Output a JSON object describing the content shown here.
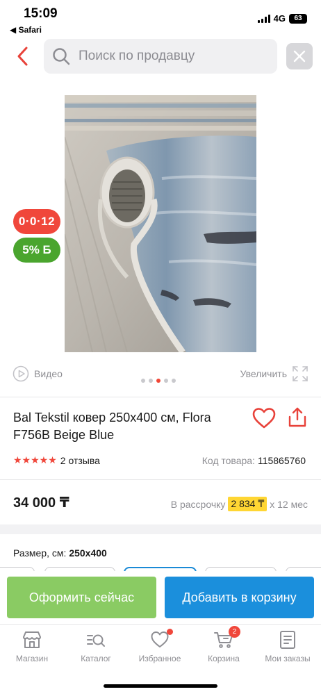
{
  "status_bar": {
    "time": "15:09",
    "back_app": "◀ Safari",
    "network": "4G",
    "battery": "63"
  },
  "search": {
    "placeholder": "Поиск по продавцу",
    "back_icon": "chevron-left-icon",
    "search_icon": "search-icon",
    "clear_icon": "close-icon"
  },
  "gallery": {
    "badge_timer": "0·0·12",
    "badge_bonus": "5% Б",
    "video_label": "Видео",
    "zoom_label": "Увеличить",
    "dots_total": 5,
    "dots_active_index": 2
  },
  "product": {
    "title": "Bal Tekstil ковер 250x400 см, Flora F756B Beige Blue",
    "stars": "★★★★★",
    "reviews": "2 отзыва",
    "code_label": "Код товара:",
    "code_value": "115865760",
    "price": "34 000 ₸",
    "installment_prefix": "В рассрочку",
    "installment_amount": "2 834 ₸",
    "installment_suffix": "x 12 мес",
    "size_label": "Размер, см:",
    "size_value": "250x400"
  },
  "actions": {
    "buy_now": "Оформить сейчас",
    "add_to_cart": "Добавить в корзину"
  },
  "tabbar": {
    "items": [
      {
        "label": "Магазин",
        "icon": "store-icon"
      },
      {
        "label": "Каталог",
        "icon": "catalog-search-icon"
      },
      {
        "label": "Избранное",
        "icon": "heart-icon"
      },
      {
        "label": "Корзина",
        "icon": "cart-icon",
        "badge": "2"
      },
      {
        "label": "Мои заказы",
        "icon": "orders-icon"
      }
    ]
  },
  "colors": {
    "accent_red": "#f0473b",
    "green": "#8acb63",
    "blue": "#1b8fdc",
    "installment_yellow": "#ffd633"
  }
}
